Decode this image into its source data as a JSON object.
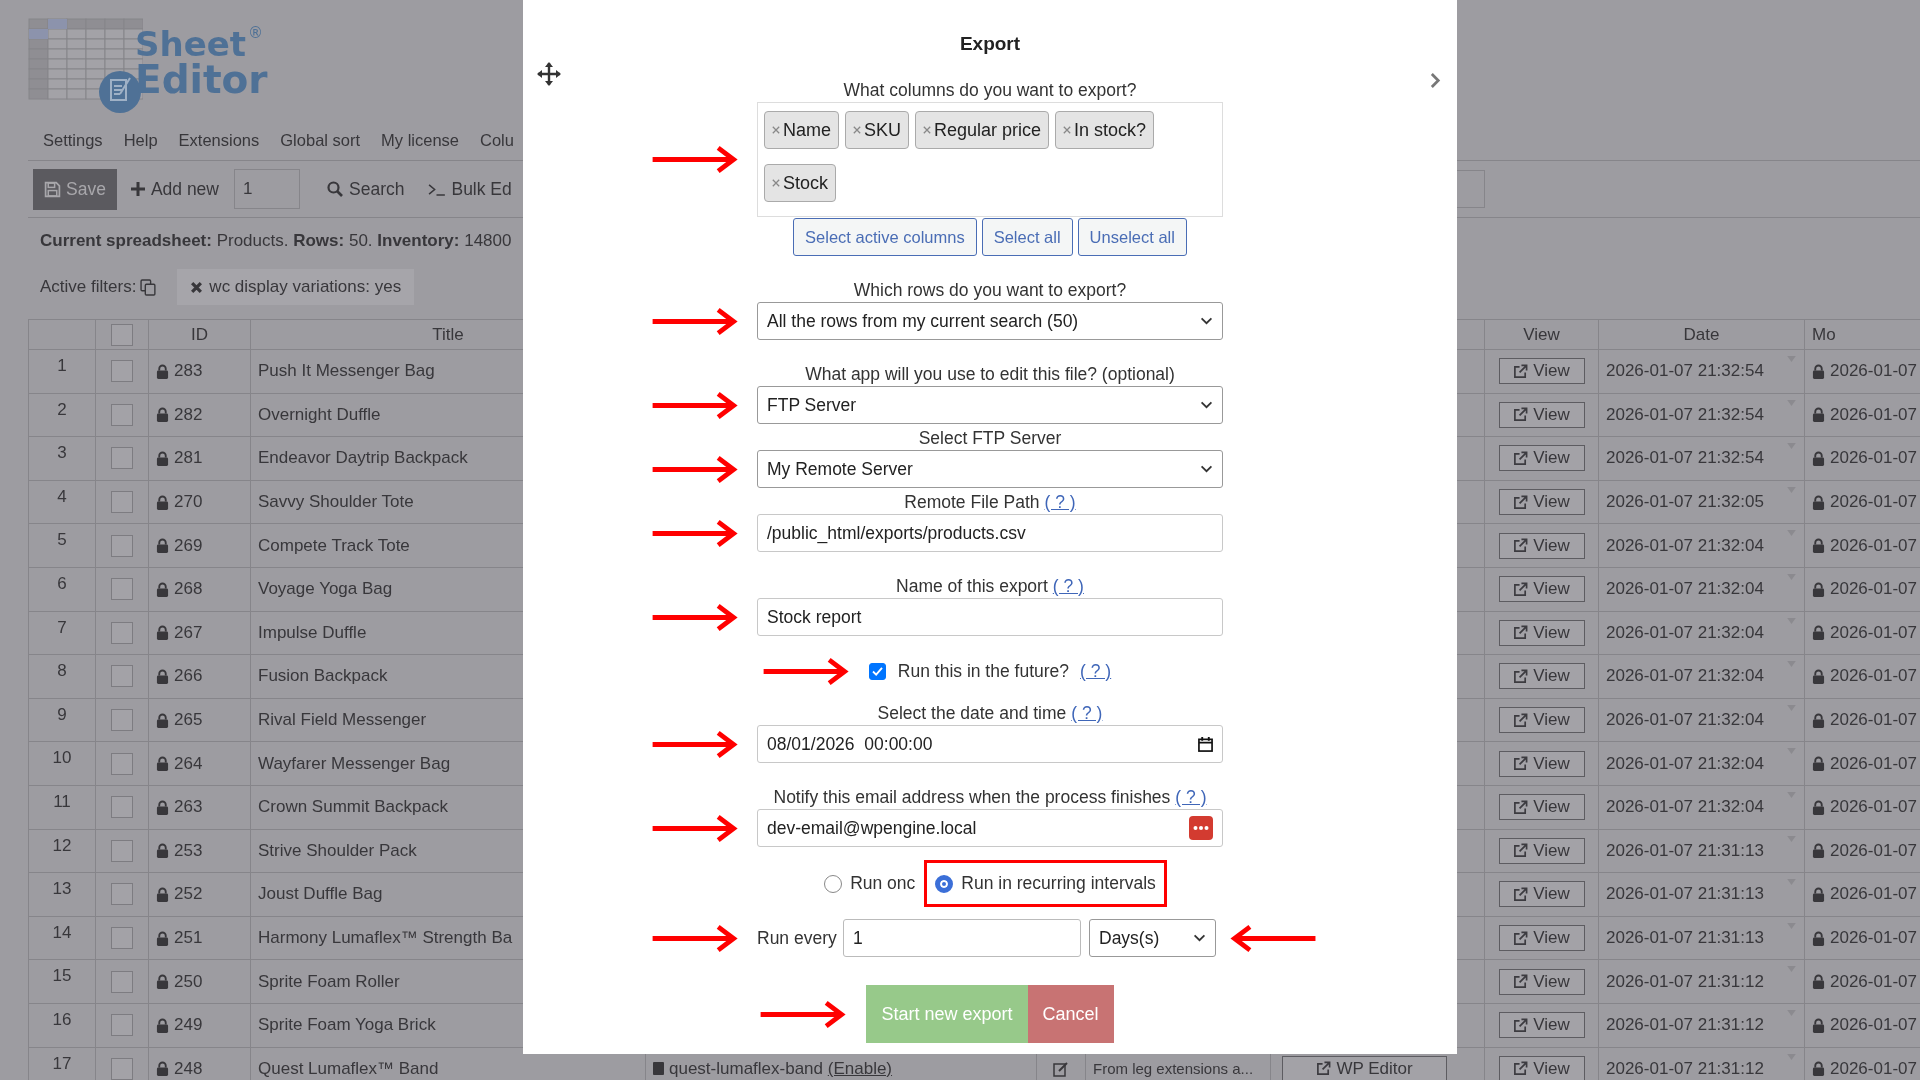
{
  "logo": {
    "line1": "Sheet",
    "line2": "Editor",
    "mark": "®"
  },
  "menu": [
    "Settings",
    "Help",
    "Extensions",
    "Global sort",
    "My license",
    "Colu"
  ],
  "toolbar": {
    "save": "Save",
    "add_new": "Add new",
    "count": "1",
    "search": "Search",
    "bulk_edit": "Bulk Ed"
  },
  "status": "**Current spreadsheet:** Products. **Rows:** 50. **Inventory:** 14800",
  "filters": {
    "label": "Active filters:",
    "chips": [
      {
        "label": "wc display variations: yes"
      }
    ]
  },
  "table": {
    "header_checked": false,
    "columns": {
      "id": "ID",
      "title": "Title",
      "view": "View",
      "date": "Date",
      "modified": "Mo"
    },
    "rows": [
      {
        "num": "1",
        "checked": false,
        "id": "283",
        "title": "Push It Messenger Bag",
        "view": "View",
        "date": "2026-01-07 21:32:54",
        "modified": "2026-01-07"
      },
      {
        "num": "2",
        "checked": false,
        "id": "282",
        "title": "Overnight Duffle",
        "view": "View",
        "date": "2026-01-07 21:32:54",
        "modified": "2026-01-07"
      },
      {
        "num": "3",
        "checked": false,
        "id": "281",
        "title": "Endeavor Daytrip Backpack",
        "view": "View",
        "date": "2026-01-07 21:32:54",
        "modified": "2026-01-07"
      },
      {
        "num": "4",
        "checked": false,
        "id": "270",
        "title": "Savvy Shoulder Tote",
        "view": "View",
        "date": "2026-01-07 21:32:05",
        "modified": "2026-01-07"
      },
      {
        "num": "5",
        "checked": false,
        "id": "269",
        "title": "Compete Track Tote",
        "view": "View",
        "date": "2026-01-07 21:32:04",
        "modified": "2026-01-07"
      },
      {
        "num": "6",
        "checked": false,
        "id": "268",
        "title": "Voyage Yoga Bag",
        "view": "View",
        "date": "2026-01-07 21:32:04",
        "modified": "2026-01-07"
      },
      {
        "num": "7",
        "checked": false,
        "id": "267",
        "title": "Impulse Duffle",
        "view": "View",
        "date": "2026-01-07 21:32:04",
        "modified": "2026-01-07"
      },
      {
        "num": "8",
        "checked": false,
        "id": "266",
        "title": "Fusion Backpack",
        "view": "View",
        "date": "2026-01-07 21:32:04",
        "modified": "2026-01-07"
      },
      {
        "num": "9",
        "checked": false,
        "id": "265",
        "title": "Rival Field Messenger",
        "view": "View",
        "date": "2026-01-07 21:32:04",
        "modified": "2026-01-07"
      },
      {
        "num": "10",
        "checked": false,
        "id": "264",
        "title": "Wayfarer Messenger Bag",
        "view": "View",
        "date": "2026-01-07 21:32:04",
        "modified": "2026-01-07"
      },
      {
        "num": "11",
        "checked": false,
        "id": "263",
        "title": "Crown Summit Backpack",
        "view": "View",
        "date": "2026-01-07 21:32:04",
        "modified": "2026-01-07"
      },
      {
        "num": "12",
        "checked": false,
        "id": "253",
        "title": "Strive Shoulder Pack",
        "view": "View",
        "date": "2026-01-07 21:31:13",
        "modified": "2026-01-07"
      },
      {
        "num": "13",
        "checked": false,
        "id": "252",
        "title": "Joust Duffle Bag",
        "view": "View",
        "date": "2026-01-07 21:31:13",
        "modified": "2026-01-07"
      },
      {
        "num": "14",
        "checked": false,
        "id": "251",
        "title": "Harmony Lumaflex™ Strength Ba",
        "view": "View",
        "date": "2026-01-07 21:31:13",
        "modified": "2026-01-07"
      },
      {
        "num": "15",
        "checked": false,
        "id": "250",
        "title": "Sprite Foam Roller",
        "view": "View",
        "date": "2026-01-07 21:31:12",
        "modified": "2026-01-07"
      },
      {
        "num": "16",
        "checked": false,
        "id": "249",
        "title": "Sprite Foam Yoga Brick",
        "view": "View",
        "date": "2026-01-07 21:31:12",
        "modified": "2026-01-07"
      },
      {
        "num": "17",
        "checked": false,
        "id": "248",
        "title": "Quest Lumaflex™ Band",
        "slug": "quest-lumaflex-band",
        "slug_link": "(Enable)",
        "description": "From leg extensions a...",
        "editor": "WP Editor",
        "view": "View",
        "date": "2026-01-07 21:31:12",
        "modified": "2026-01-07"
      }
    ]
  },
  "modal": {
    "title": "Export",
    "sections": [
      {
        "kind": "columns",
        "label": "What columns do you want to export?",
        "tags": [
          "Name",
          "SKU",
          "Regular price",
          "In stock?",
          "Stock"
        ],
        "buttons": [
          "Select active columns",
          "Select all",
          "Unselect all"
        ],
        "pointer": true
      },
      {
        "kind": "select",
        "label": "Which rows do you want to export?",
        "value": "All the rows from my current search (50)",
        "pointer": true
      },
      {
        "kind": "select",
        "label": "What app will you use to edit this file? (optional)",
        "value": "FTP Server",
        "pointer": true
      },
      {
        "kind": "select",
        "label": "Select FTP Server",
        "value": "My Remote Server",
        "pointer": true
      },
      {
        "kind": "input",
        "label": "Remote File Path",
        "help": "( ? )",
        "value": "/public_html/exports/products.csv",
        "pointer": true
      },
      {
        "kind": "input",
        "label": "Name of this export",
        "help": "( ? )",
        "value": "Stock report",
        "pointer": true
      },
      {
        "kind": "checkbox",
        "label": "Run this in the future?",
        "help": "( ? )",
        "checked": true,
        "pointer": true
      },
      {
        "kind": "date",
        "label": "Select the date and time",
        "help": "( ? )",
        "value": "08/01/2026  00:00:00",
        "pointer": true
      },
      {
        "kind": "email",
        "label": "Notify this email address when the process finishes",
        "help": "( ? )",
        "value": "dev-email@wpengine.local",
        "pointer": true
      },
      {
        "kind": "radio",
        "options": [
          {
            "label": "Run onc",
            "selected": false,
            "highlighted": false
          },
          {
            "label": "Run in recurring intervals",
            "selected": true,
            "highlighted": true
          }
        ]
      },
      {
        "kind": "interval",
        "label": "Run every",
        "value": "1",
        "unit": "Days(s)",
        "pointer": true,
        "pointer_after": true
      },
      {
        "kind": "actions",
        "buttons": [
          {
            "label": "Start new export",
            "kind": "primary"
          },
          {
            "label": "Cancel",
            "kind": "danger"
          }
        ],
        "pointer": true
      }
    ]
  }
}
